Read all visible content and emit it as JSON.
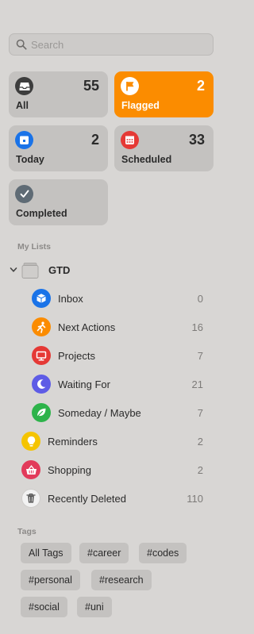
{
  "search": {
    "placeholder": "Search"
  },
  "smart_lists": [
    {
      "label": "All",
      "count": "55",
      "color": "#3d3d3d"
    },
    {
      "label": "Flagged",
      "count": "2",
      "color": "#fb8c00"
    },
    {
      "label": "Today",
      "count": "2",
      "color": "#1a73e8"
    },
    {
      "label": "Scheduled",
      "count": "33",
      "color": "#e53935"
    },
    {
      "label": "Completed",
      "count": "",
      "color": "#5f6b75"
    }
  ],
  "my_lists_header": "My Lists",
  "group": {
    "label": "GTD"
  },
  "lists": [
    {
      "label": "Inbox",
      "count": "0",
      "icon": "cube-icon",
      "color": "#1a73e8"
    },
    {
      "label": "Next Actions",
      "count": "16",
      "icon": "running-person-icon",
      "color": "#fb8c00"
    },
    {
      "label": "Projects",
      "count": "7",
      "icon": "monitor-icon",
      "color": "#e53935"
    },
    {
      "label": "Waiting For",
      "count": "21",
      "icon": "moon-icon",
      "color": "#5e5ce6"
    },
    {
      "label": "Someday / Maybe",
      "count": "7",
      "icon": "leaf-icon",
      "color": "#2db34a"
    },
    {
      "label": "Reminders",
      "count": "2",
      "icon": "lightbulb-icon",
      "color": "#f5c400"
    },
    {
      "label": "Shopping",
      "count": "2",
      "icon": "basket-icon",
      "color": "#e23a5a"
    },
    {
      "label": "Recently Deleted",
      "count": "110",
      "icon": "trash-icon",
      "color": "#f2f2f2"
    }
  ],
  "tags_header": "Tags",
  "tags": [
    "All Tags",
    "#career",
    "#codes",
    "#personal",
    "#research",
    "#social",
    "#uni"
  ]
}
